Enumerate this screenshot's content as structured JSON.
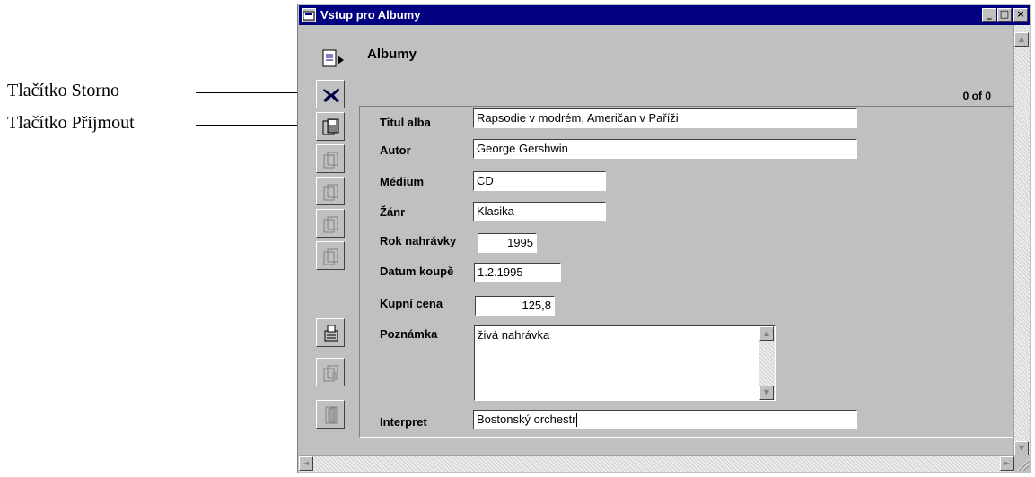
{
  "callouts": {
    "cancel": "Tlačítko Storno",
    "accept": "Tlačítko Přijmout"
  },
  "window": {
    "title": "Vstup pro Albumy",
    "minimize": "_",
    "maximize": "□",
    "close": "×"
  },
  "form": {
    "title": "Albumy",
    "counter": "0 of 0"
  },
  "toolbar": [
    {
      "name": "form-menu-button",
      "icon": "form-menu-icon",
      "enabled": true
    },
    {
      "name": "cancel-button",
      "icon": "cancel-x-icon",
      "enabled": true
    },
    {
      "name": "accept-button",
      "icon": "accept-disk-icon",
      "enabled": true
    },
    {
      "name": "first-record-button",
      "icon": "record-nav-icon",
      "enabled": false
    },
    {
      "name": "previous-record-button",
      "icon": "record-nav-icon",
      "enabled": false
    },
    {
      "name": "next-record-button",
      "icon": "record-nav-icon",
      "enabled": false
    },
    {
      "name": "last-record-button",
      "icon": "record-nav-icon",
      "enabled": false
    },
    {
      "name": "print-button",
      "icon": "printer-icon",
      "enabled": true
    },
    {
      "name": "delete-button",
      "icon": "record-nav-icon",
      "enabled": false
    },
    {
      "name": "exit-button",
      "icon": "exit-door-icon",
      "enabled": false
    }
  ],
  "fields": {
    "title": {
      "label": "Titul alba",
      "value": "Rapsodie v modrém, Američan v Paříži"
    },
    "author": {
      "label": "Autor",
      "value": "George Gershwin"
    },
    "medium": {
      "label": "Médium",
      "value": "CD"
    },
    "genre": {
      "label": "Žánr",
      "value": "Klasika"
    },
    "year": {
      "label": "Rok nahrávky",
      "value": "1995"
    },
    "purchase_date": {
      "label": "Datum koupě",
      "value": "1.2.1995"
    },
    "price": {
      "label": "Kupní cena",
      "value": "125,8"
    },
    "note": {
      "label": "Poznámka",
      "value": "živá nahrávka"
    },
    "performer": {
      "label": "Interpret",
      "value": "Bostonský orchestr"
    }
  },
  "scroll_arrows": {
    "up": "▲",
    "down": "▼",
    "left": "◄",
    "right": "►"
  }
}
